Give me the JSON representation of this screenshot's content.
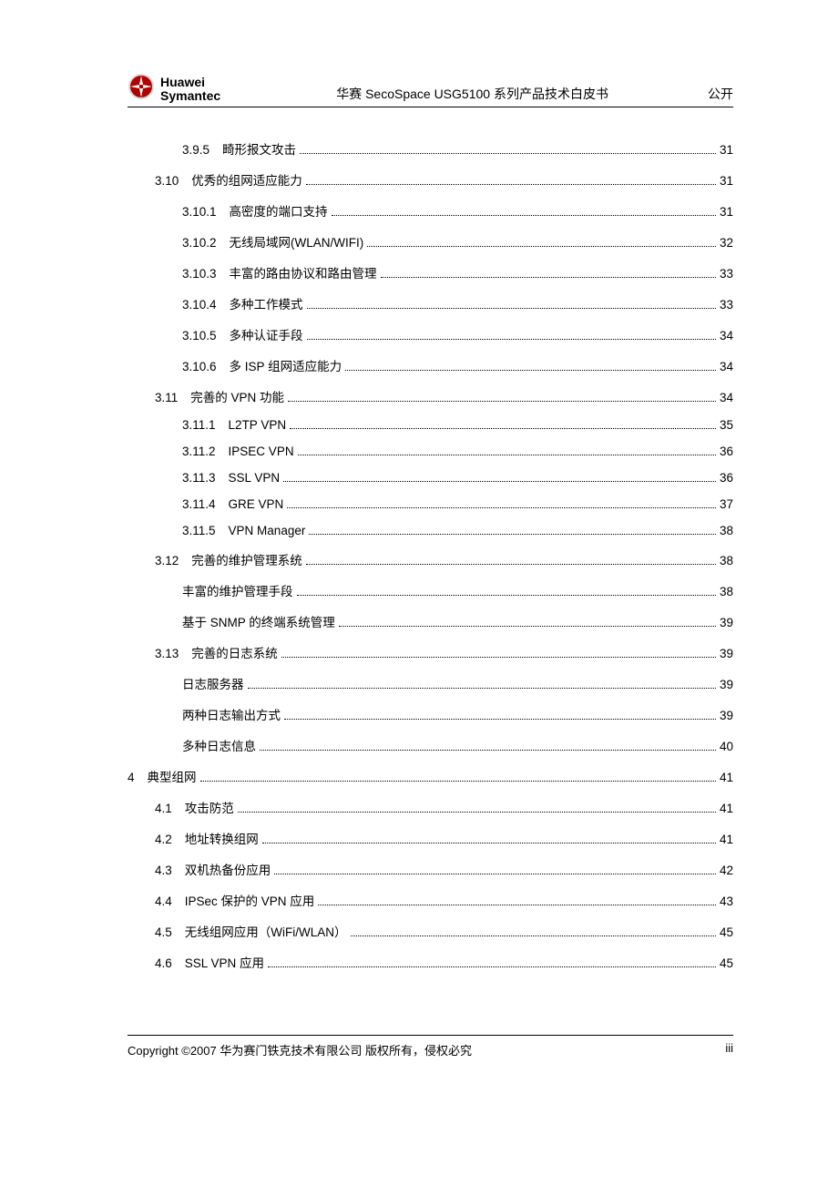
{
  "header": {
    "brand_line1": "Huawei",
    "brand_line2": "Symantec",
    "title": "华赛 SecoSpace USG5100 系列产品技术白皮书",
    "right": "公开"
  },
  "toc": [
    {
      "level": 3,
      "num": "3.9.5",
      "title": "畸形报文攻击",
      "page": "31"
    },
    {
      "level": 2,
      "num": "3.10",
      "title": "优秀的组网适应能力",
      "page": "31"
    },
    {
      "level": 3,
      "num": "3.10.1",
      "title": "高密度的端口支持",
      "page": "31"
    },
    {
      "level": 3,
      "num": "3.10.2",
      "title": "无线局域网(WLAN/WIFI)",
      "page": "32"
    },
    {
      "level": 3,
      "num": "3.10.3",
      "title": "丰富的路由协议和路由管理",
      "page": "33"
    },
    {
      "level": 3,
      "num": "3.10.4",
      "title": "多种工作模式",
      "page": "33"
    },
    {
      "level": 3,
      "num": "3.10.5",
      "title": "多种认证手段",
      "page": "34"
    },
    {
      "level": 3,
      "num": "3.10.6",
      "title": "多 ISP 组网适应能力",
      "page": "34"
    },
    {
      "level": 2,
      "num": "3.11",
      "title": "完善的 VPN 功能",
      "page": "34"
    },
    {
      "level": 3,
      "num": "3.11.1",
      "title": "L2TP VPN",
      "page": "35"
    },
    {
      "level": 3,
      "num": "3.11.2",
      "title": "IPSEC VPN",
      "page": "36"
    },
    {
      "level": 3,
      "num": "3.11.3",
      "title": "SSL VPN",
      "page": "36"
    },
    {
      "level": 3,
      "num": "3.11.4",
      "title": "GRE VPN",
      "page": "37"
    },
    {
      "level": 3,
      "num": "3.11.5",
      "title": "VPN Manager",
      "page": "38"
    },
    {
      "level": 2,
      "num": "3.12",
      "title": "完善的维护管理系统",
      "page": "38"
    },
    {
      "level": 3,
      "num": "",
      "title": "丰富的维护管理手段",
      "page": "38"
    },
    {
      "level": 3,
      "num": "",
      "title": "基于 SNMP 的终端系统管理",
      "page": "39"
    },
    {
      "level": 2,
      "num": "3.13",
      "title": "完善的日志系统",
      "page": "39"
    },
    {
      "level": 3,
      "num": "",
      "title": "日志服务器",
      "page": "39"
    },
    {
      "level": 3,
      "num": "",
      "title": "两种日志输出方式",
      "page": "39"
    },
    {
      "level": 3,
      "num": "",
      "title": "多种日志信息",
      "page": "40"
    },
    {
      "level": 1,
      "num": "4",
      "title": "典型组网",
      "page": "41"
    },
    {
      "level": 2,
      "num": "4.1",
      "title": "攻击防范",
      "page": "41"
    },
    {
      "level": 2,
      "num": "4.2",
      "title": "地址转换组网",
      "page": "41"
    },
    {
      "level": 2,
      "num": "4.3",
      "title": "双机热备份应用",
      "page": "42"
    },
    {
      "level": 2,
      "num": "4.4",
      "title": "IPSec 保护的 VPN 应用",
      "page": "43"
    },
    {
      "level": 2,
      "num": "4.5",
      "title": "无线组网应用（WiFi/WLAN）",
      "page": "45"
    },
    {
      "level": 2,
      "num": "4.6",
      "title": "SSL VPN 应用",
      "page": "45"
    }
  ],
  "footer": {
    "left": "Copyright ©2007  华为赛门铁克技术有限公司    版权所有，侵权必究",
    "right": "iii"
  }
}
